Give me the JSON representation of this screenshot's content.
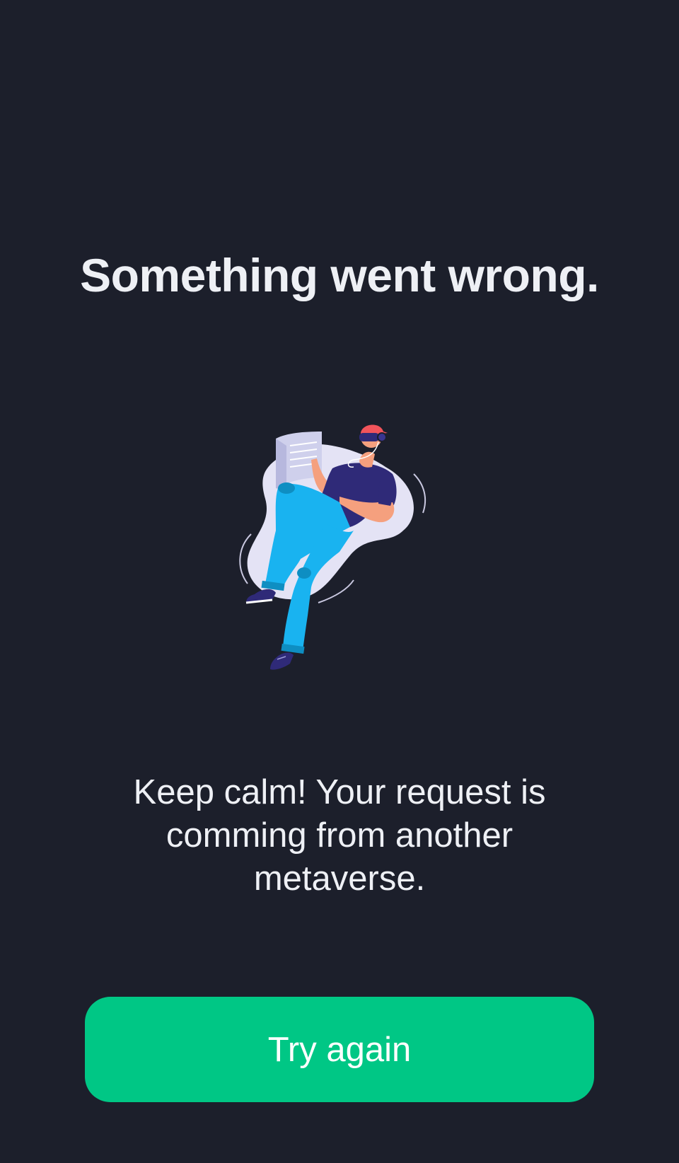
{
  "error": {
    "title": "Something went wrong.",
    "message": "Keep calm! Your request is comming from another metaverse.",
    "illustration_icon": "person-with-vr-headset-icon"
  },
  "actions": {
    "retry_label": "Try again"
  },
  "colors": {
    "background": "#1c1f2b",
    "text": "#eef0f5",
    "accent": "#00c785"
  }
}
